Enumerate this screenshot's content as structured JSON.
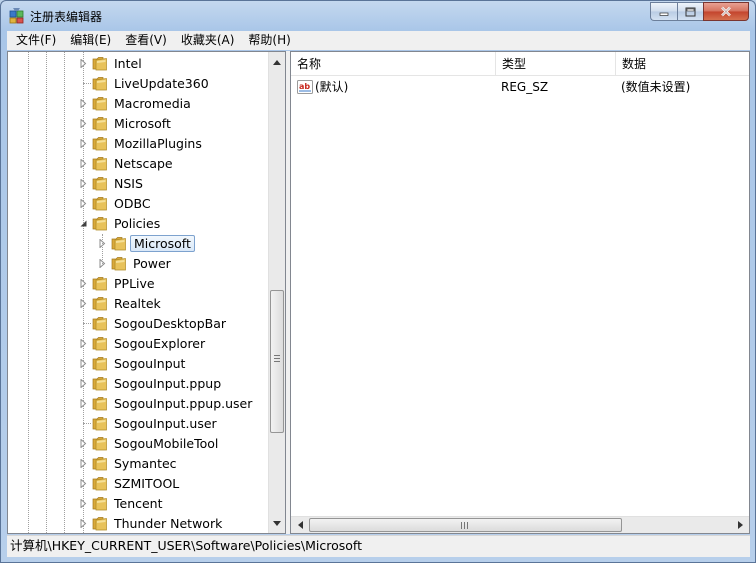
{
  "window": {
    "title": "注册表编辑器",
    "icon": "regedit-icon"
  },
  "caption": {
    "minimize": "minimize-icon",
    "maximize": "maximize-icon",
    "close": "close-icon"
  },
  "menu": [
    "文件(F)",
    "编辑(E)",
    "查看(V)",
    "收藏夹(A)",
    "帮助(H)"
  ],
  "tree": {
    "items": [
      {
        "label": "Intel",
        "level": 0,
        "expander": "collapsed"
      },
      {
        "label": "LiveUpdate360",
        "level": 0,
        "expander": "none"
      },
      {
        "label": "Macromedia",
        "level": 0,
        "expander": "collapsed"
      },
      {
        "label": "Microsoft",
        "level": 0,
        "expander": "collapsed"
      },
      {
        "label": "MozillaPlugins",
        "level": 0,
        "expander": "collapsed"
      },
      {
        "label": "Netscape",
        "level": 0,
        "expander": "collapsed"
      },
      {
        "label": "NSIS",
        "level": 0,
        "expander": "collapsed"
      },
      {
        "label": "ODBC",
        "level": 0,
        "expander": "collapsed"
      },
      {
        "label": "Policies",
        "level": 0,
        "expander": "expanded"
      },
      {
        "label": "Microsoft",
        "level": 1,
        "expander": "collapsed",
        "selected": true
      },
      {
        "label": "Power",
        "level": 1,
        "expander": "collapsed"
      },
      {
        "label": "PPLive",
        "level": 0,
        "expander": "collapsed"
      },
      {
        "label": "Realtek",
        "level": 0,
        "expander": "collapsed"
      },
      {
        "label": "SogouDesktopBar",
        "level": 0,
        "expander": "none"
      },
      {
        "label": "SogouExplorer",
        "level": 0,
        "expander": "collapsed"
      },
      {
        "label": "SogouInput",
        "level": 0,
        "expander": "collapsed"
      },
      {
        "label": "SogouInput.ppup",
        "level": 0,
        "expander": "collapsed"
      },
      {
        "label": "SogouInput.ppup.user",
        "level": 0,
        "expander": "collapsed"
      },
      {
        "label": "SogouInput.user",
        "level": 0,
        "expander": "none"
      },
      {
        "label": "SogouMobileTool",
        "level": 0,
        "expander": "collapsed"
      },
      {
        "label": "Symantec",
        "level": 0,
        "expander": "collapsed"
      },
      {
        "label": "SZMITOOL",
        "level": 0,
        "expander": "collapsed"
      },
      {
        "label": "Tencent",
        "level": 0,
        "expander": "collapsed"
      },
      {
        "label": "Thunder Network",
        "level": 0,
        "expander": "collapsed"
      }
    ]
  },
  "list": {
    "columns": [
      "名称",
      "类型",
      "数据"
    ],
    "rows": [
      {
        "name": "(默认)",
        "type": "REG_SZ",
        "data": "(数值未设置)",
        "icon": "string-value-icon"
      }
    ]
  },
  "status": {
    "path": "计算机\\HKEY_CURRENT_USER\\Software\\Policies\\Microsoft"
  },
  "colors": {
    "folder": "#e8c25a",
    "selection_border": "#7da2ce",
    "close_button": "#c3432c"
  }
}
